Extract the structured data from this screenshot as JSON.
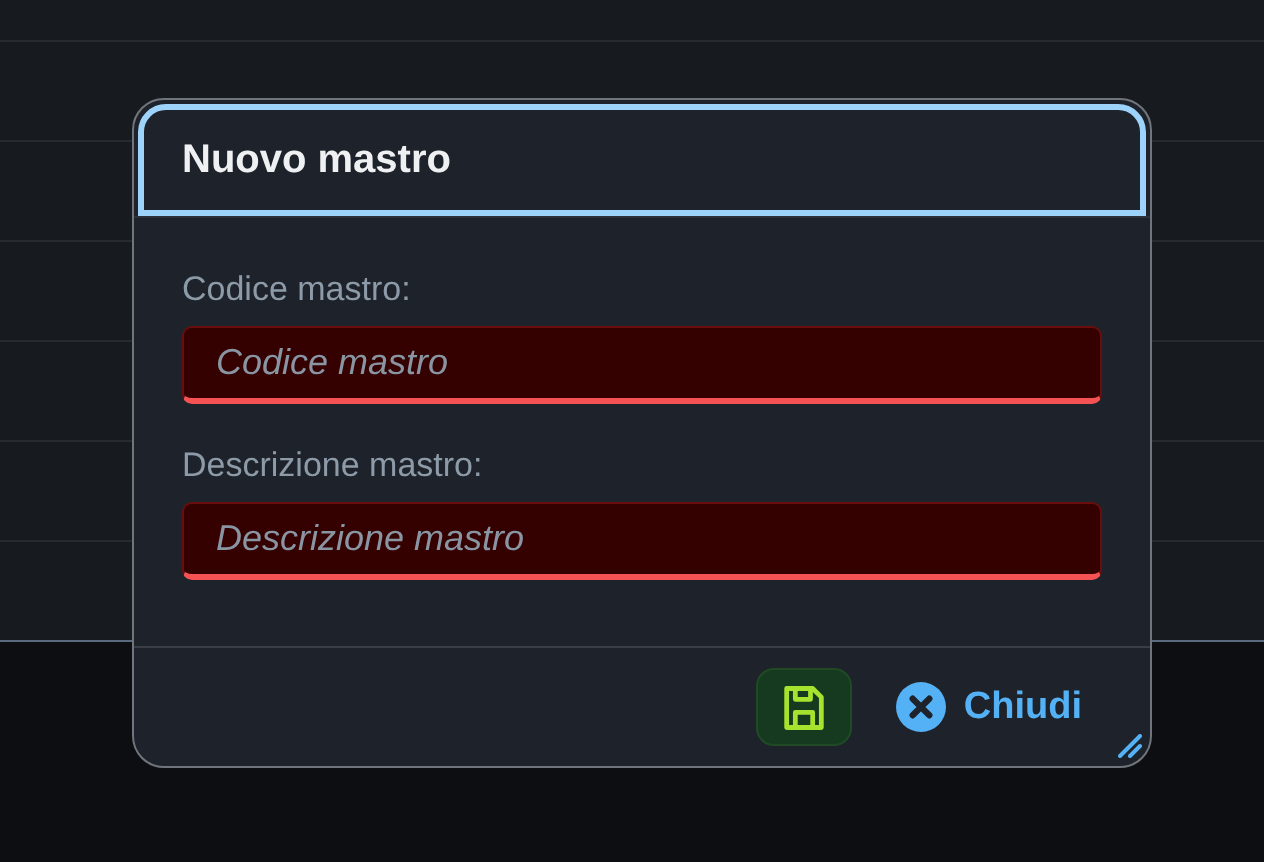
{
  "dialog": {
    "title": "Nuovo mastro",
    "fields": [
      {
        "label": "Codice mastro:",
        "placeholder": "Codice mastro",
        "invalid": true
      },
      {
        "label": "Descrizione mastro:",
        "placeholder": "Descrizione mastro",
        "invalid": true
      }
    ],
    "close_button": {
      "label": "Chiudi"
    }
  }
}
